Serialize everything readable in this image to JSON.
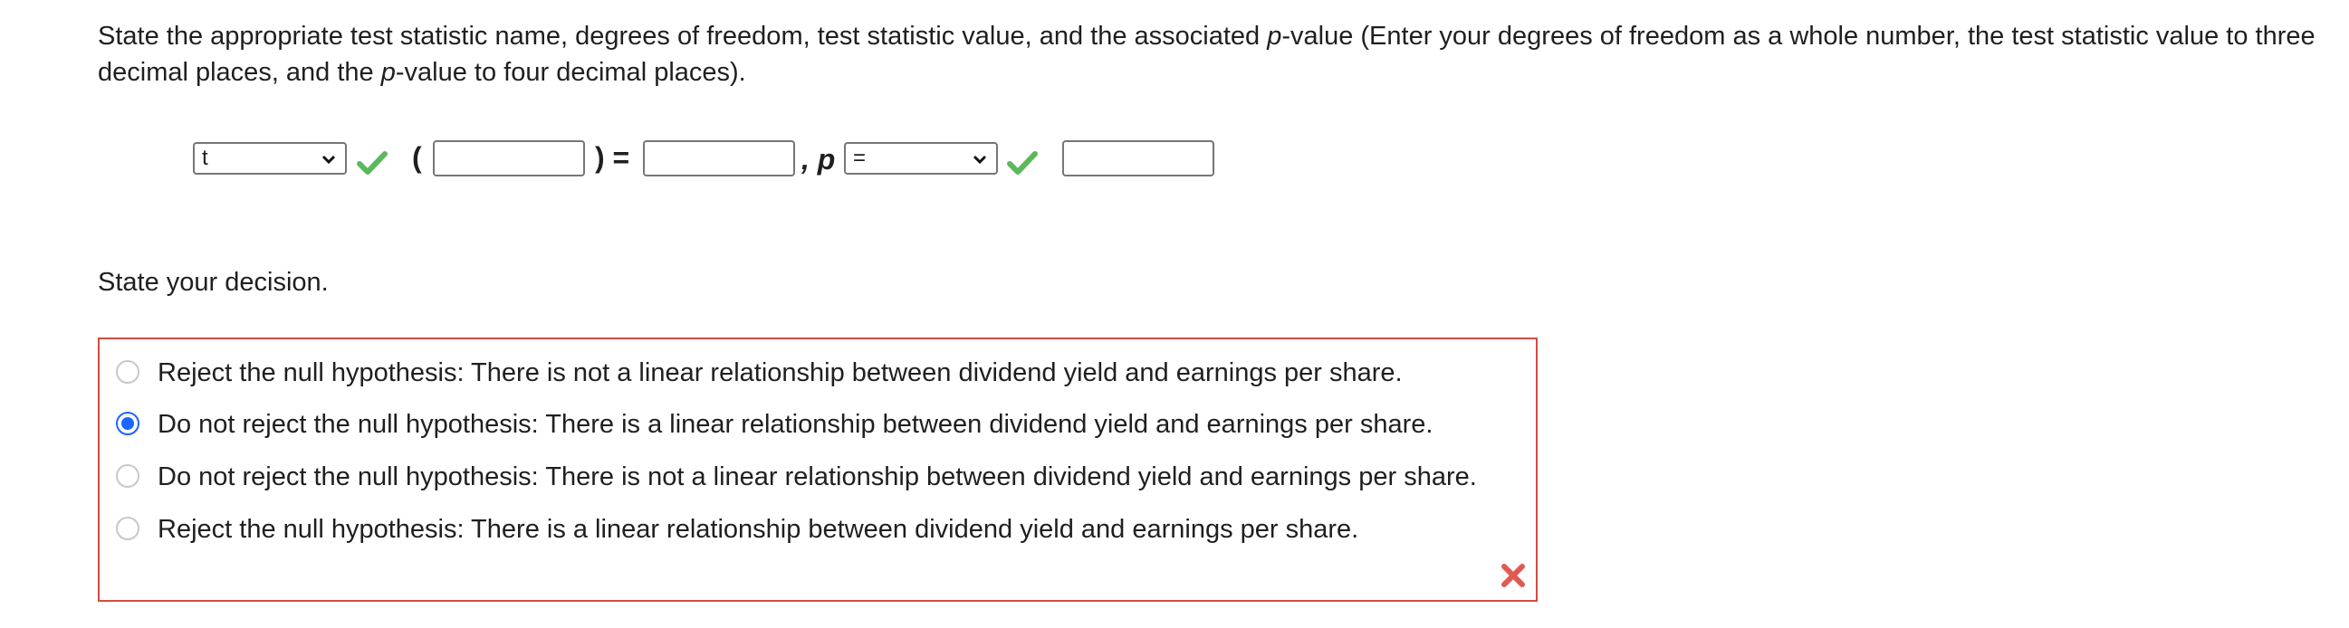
{
  "prompt": {
    "part1": "State the appropriate test statistic name, degrees of freedom, test statistic value, and the associated ",
    "p_italic": "p",
    "part2": "-value (Enter your degrees of freedom as a whole number, the test statistic value to three decimal places, and the ",
    "p_italic2": "p",
    "part3": "-value to four decimal places)."
  },
  "answer_row": {
    "stat_select_value": "t",
    "open_paren": "(",
    "df_value": "",
    "close_paren_equals": ") =",
    "stat_value": "",
    "comma_p": ", p",
    "relation_select_value": "=",
    "p_value": ""
  },
  "decision": {
    "label": "State your decision.",
    "options": [
      {
        "text": "Reject the null hypothesis: There is not a linear relationship between dividend yield and earnings per share.",
        "checked": false
      },
      {
        "text": "Do not reject the null hypothesis: There is a linear relationship between dividend yield and earnings per share.",
        "checked": true
      },
      {
        "text": "Do not reject the null hypothesis: There is not a linear relationship between dividend yield and earnings per share.",
        "checked": false
      },
      {
        "text": "Reject the null hypothesis: There is a linear relationship between dividend yield and earnings per share.",
        "checked": false
      }
    ]
  },
  "colors": {
    "correct": "#5cb85c",
    "incorrect": "#e05a52",
    "radio_selected": "#1a66ff",
    "error_border": "#d14b42"
  },
  "icons": {
    "correct": "checkmark-icon",
    "incorrect": "x-mark-icon",
    "dropdown": "chevron-down-icon"
  }
}
